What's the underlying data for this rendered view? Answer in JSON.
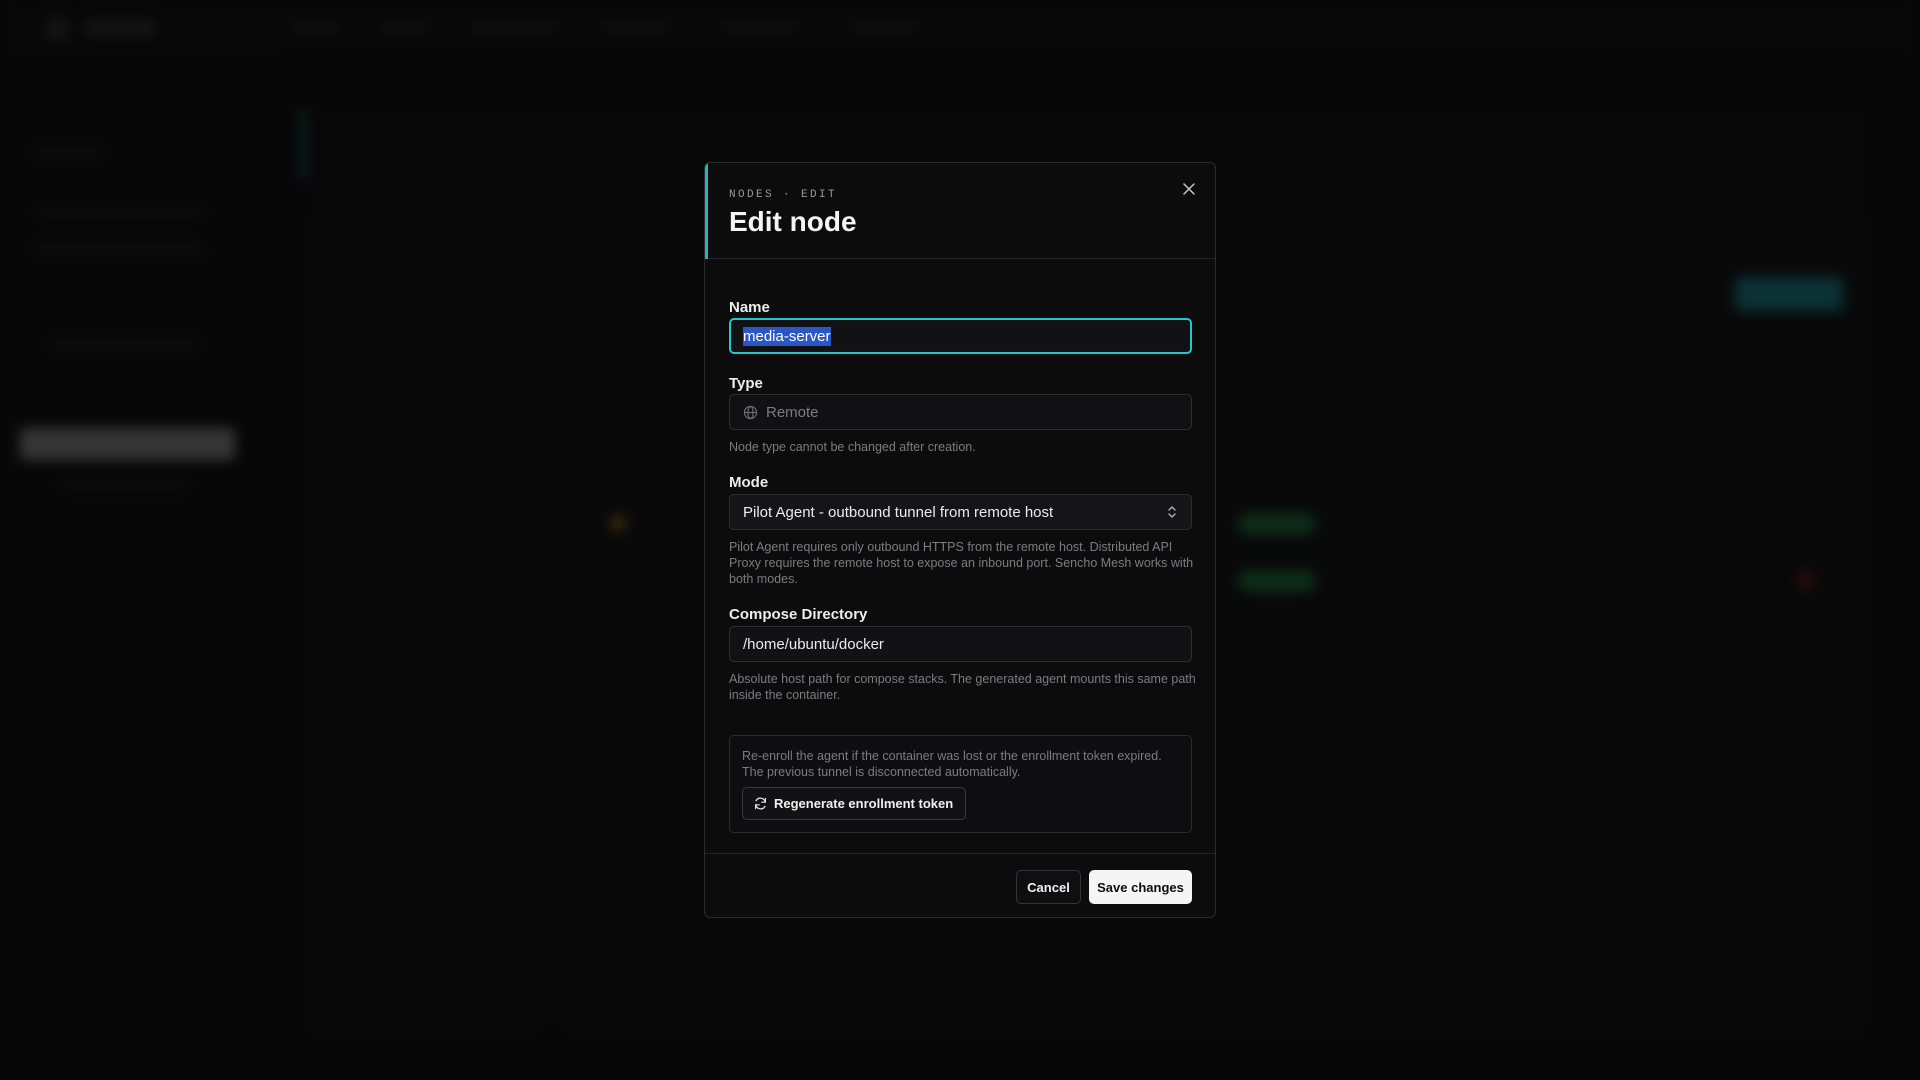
{
  "colors": {
    "accent": "#23b3b8",
    "focus_ring": "#2bc4c9",
    "selection": "#2a56c6",
    "primary_button_bg": "#f5f5f5"
  },
  "modal": {
    "eyebrow": "NODES · EDIT",
    "title": "Edit node",
    "close_icon": "close-icon",
    "name": {
      "label": "Name",
      "value": "media-server"
    },
    "type": {
      "label": "Type",
      "value": "Remote",
      "icon": "globe-icon",
      "help": "Node type cannot be changed after creation."
    },
    "mode": {
      "label": "Mode",
      "value": "Pilot Agent - outbound tunnel from remote host",
      "icon": "chevron-up-down-icon",
      "help": "Pilot Agent requires only outbound HTTPS from the remote host. Distributed API Proxy requires the remote host to expose an inbound port. Sencho Mesh works with both modes."
    },
    "compose": {
      "label": "Compose Directory",
      "value": "/home/ubuntu/docker",
      "help": "Absolute host path for compose stacks. The generated agent mounts this same path inside the container."
    },
    "regenerate": {
      "text": "Re-enroll the agent if the container was lost or the enrollment token expired. The previous tunnel is disconnected automatically.",
      "button_label": "Regenerate enrollment token",
      "icon": "refresh-icon"
    },
    "footer": {
      "cancel_label": "Cancel",
      "save_label": "Save changes"
    }
  }
}
